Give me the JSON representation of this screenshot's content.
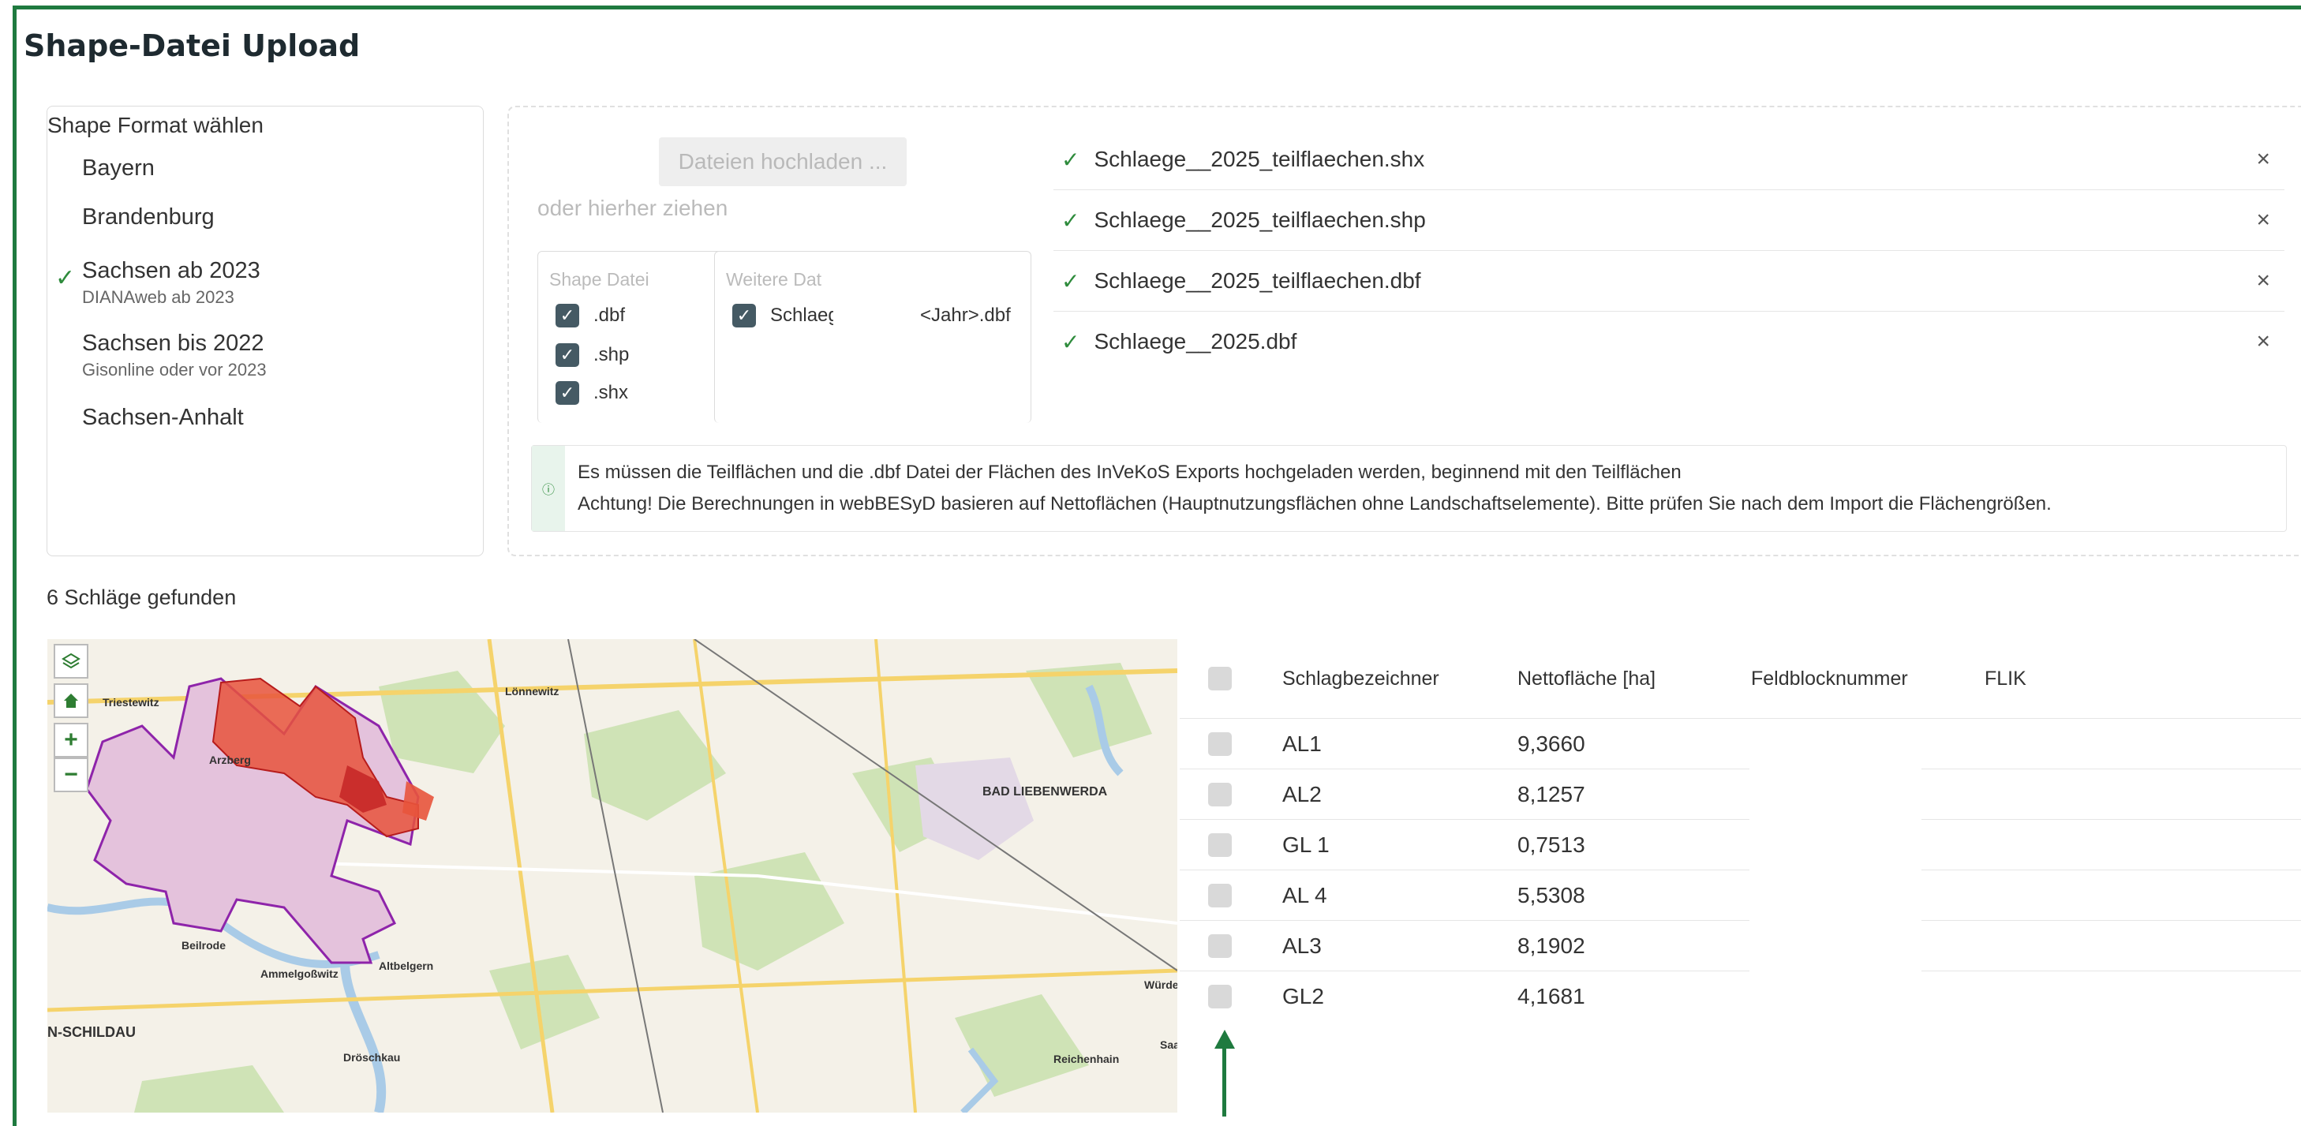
{
  "page": {
    "title": "Shape-Datei Upload"
  },
  "format": {
    "label": "Shape Format wählen",
    "items": [
      {
        "label": "Bayern",
        "sub": "",
        "selected": false
      },
      {
        "label": "Brandenburg",
        "sub": "",
        "selected": false
      },
      {
        "label": "Sachsen ab 2023",
        "sub": "DIANAweb ab 2023",
        "selected": true
      },
      {
        "label": "Sachsen bis 2022",
        "sub": "Gisonline oder vor 2023",
        "selected": false
      },
      {
        "label": "Sachsen-Anhalt",
        "sub": "",
        "selected": false
      }
    ]
  },
  "upload": {
    "button_label": "Dateien hochladen ...",
    "drag_hint": "oder hierher ziehen",
    "shape_box": {
      "title": "Shape Datei",
      "items": [
        ".dbf",
        ".shp",
        ".shx"
      ]
    },
    "extra_box": {
      "title": "Weitere Dat",
      "item_a": "Schlaeg",
      "item_b": "<Jahr>.dbf"
    },
    "files": [
      "Schlaege__2025_teilflaechen.shx",
      "Schlaege__2025_teilflaechen.shp",
      "Schlaege__2025_teilflaechen.dbf",
      "Schlaege__2025.dbf"
    ],
    "notice": {
      "line1": "Es müssen die Teilflächen und die .dbf Datei der Flächen des InVeKoS Exports hochgeladen werden, beginnend mit den Teilflächen",
      "line2": "Achtung! Die Berechnungen in webBESyD basieren auf Nettoflächen (Hauptnutzungsflächen ohne Landschaftselemente). Bitte prüfen Sie nach dem Import die Flächengrößen."
    }
  },
  "results": {
    "count_text": "6 Schläge gefunden"
  },
  "map": {
    "labels": [
      "Triestewitz",
      "Lönnewitz",
      "Arzberg",
      "Beilrode",
      "Ammelgoßwitz",
      "Altbelgern",
      "BAD LIEBENWERDA",
      "N-SCHILDAU",
      "Dröschkau",
      "Reichenhain",
      "Saat",
      "Würde"
    ],
    "colors": {
      "field_fill": "#e8543c",
      "area_fill": "#e4c2dc",
      "area_stroke": "#8e24aa",
      "water": "#a9cbe7",
      "forest": "#cde3b4"
    }
  },
  "table": {
    "columns": [
      "Schlagbezeichner",
      "Nettofläche [ha]",
      "Feldblocknummer",
      "FLIK"
    ],
    "rows": [
      {
        "name": "AL1",
        "area": "9,3660"
      },
      {
        "name": "AL2",
        "area": "8,1257"
      },
      {
        "name": "GL 1",
        "area": "0,7513"
      },
      {
        "name": "AL 4",
        "area": "5,5308"
      },
      {
        "name": "AL3",
        "area": "8,1902"
      },
      {
        "name": "GL2",
        "area": "4,1681"
      }
    ]
  },
  "icons": {
    "check": "✓",
    "close": "×",
    "layers": "layers-icon",
    "home": "home-icon",
    "plus": "+",
    "minus": "−",
    "info": "ⓘ"
  }
}
